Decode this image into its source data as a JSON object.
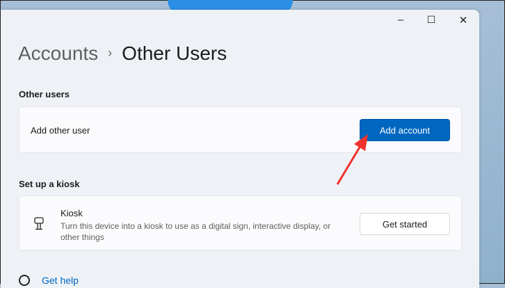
{
  "window": {
    "minimize": "–",
    "maximize": "☐",
    "close": "✕"
  },
  "breadcrumb": {
    "parent": "Accounts",
    "separator": "›",
    "current": "Other Users"
  },
  "other_users": {
    "heading": "Other users",
    "label": "Add other user",
    "button": "Add account"
  },
  "kiosk": {
    "heading": "Set up a kiosk",
    "title": "Kiosk",
    "description": "Turn this device into a kiosk to use as a digital sign, interactive display, or other things",
    "button": "Get started"
  },
  "help": {
    "link": "Get help"
  },
  "colors": {
    "accent": "#0067c0",
    "arrow": "#f0312b"
  }
}
